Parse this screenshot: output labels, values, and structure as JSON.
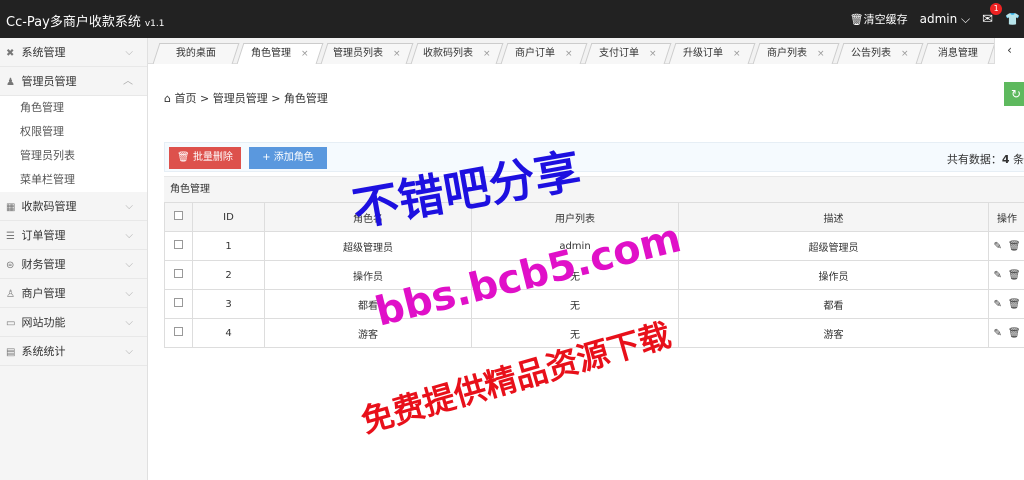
{
  "header": {
    "brand": "Cc-Pay多商户收款系统",
    "version": "v1.1",
    "clear_cache": "清空缓存",
    "user": "admin",
    "message_count": "1"
  },
  "sidebar": {
    "items": [
      {
        "label": "系统管理",
        "icon": "wrench-icon"
      },
      {
        "label": "管理员管理",
        "icon": "user-icon",
        "expanded": true,
        "children": [
          "角色管理",
          "权限管理",
          "管理员列表",
          "菜单栏管理"
        ]
      },
      {
        "label": "收款码管理",
        "icon": "grid-icon"
      },
      {
        "label": "订单管理",
        "icon": "list-icon"
      },
      {
        "label": "财务管理",
        "icon": "money-icon"
      },
      {
        "label": "商户管理",
        "icon": "user-icon"
      },
      {
        "label": "网站功能",
        "icon": "window-icon"
      },
      {
        "label": "系统统计",
        "icon": "chart-icon"
      }
    ]
  },
  "tabs": [
    "我的桌面",
    "角色管理",
    "管理员列表",
    "收款码列表",
    "商户订单",
    "支付订单",
    "升级订单",
    "商户列表",
    "公告列表",
    "消息管理"
  ],
  "active_tab": "角色管理",
  "breadcrumb": {
    "home": "首页",
    "level1": "管理员管理",
    "level2": "角色管理",
    "sep": ">"
  },
  "toolbar": {
    "delete_label": "批量删除",
    "add_label": "添加角色",
    "total_prefix": "共有数据：",
    "total_count": "4",
    "total_suffix": " 条"
  },
  "table": {
    "caption": "角色管理",
    "headers": [
      "ID",
      "角色名",
      "用户列表",
      "描述",
      "操作"
    ],
    "rows": [
      {
        "id": "1",
        "name": "超级管理员",
        "users": "admin",
        "desc": "超级管理员"
      },
      {
        "id": "2",
        "name": "操作员",
        "users": "无",
        "desc": "操作员"
      },
      {
        "id": "3",
        "name": "都看",
        "users": "无",
        "desc": "都看"
      },
      {
        "id": "4",
        "name": "游客",
        "users": "无",
        "desc": "游客"
      }
    ]
  },
  "watermark": {
    "line1": "不错吧分享",
    "line2": "bbs.bcb5.com",
    "line3": "免费提供精品资源下载"
  },
  "colors": {
    "topbar": "#222222",
    "danger": "#dd514c",
    "primary": "#5a98de",
    "success": "#5eb95e",
    "watermark_blue": "#1d10e0",
    "watermark_magenta": "#e010c8",
    "watermark_red": "#e8101a"
  }
}
